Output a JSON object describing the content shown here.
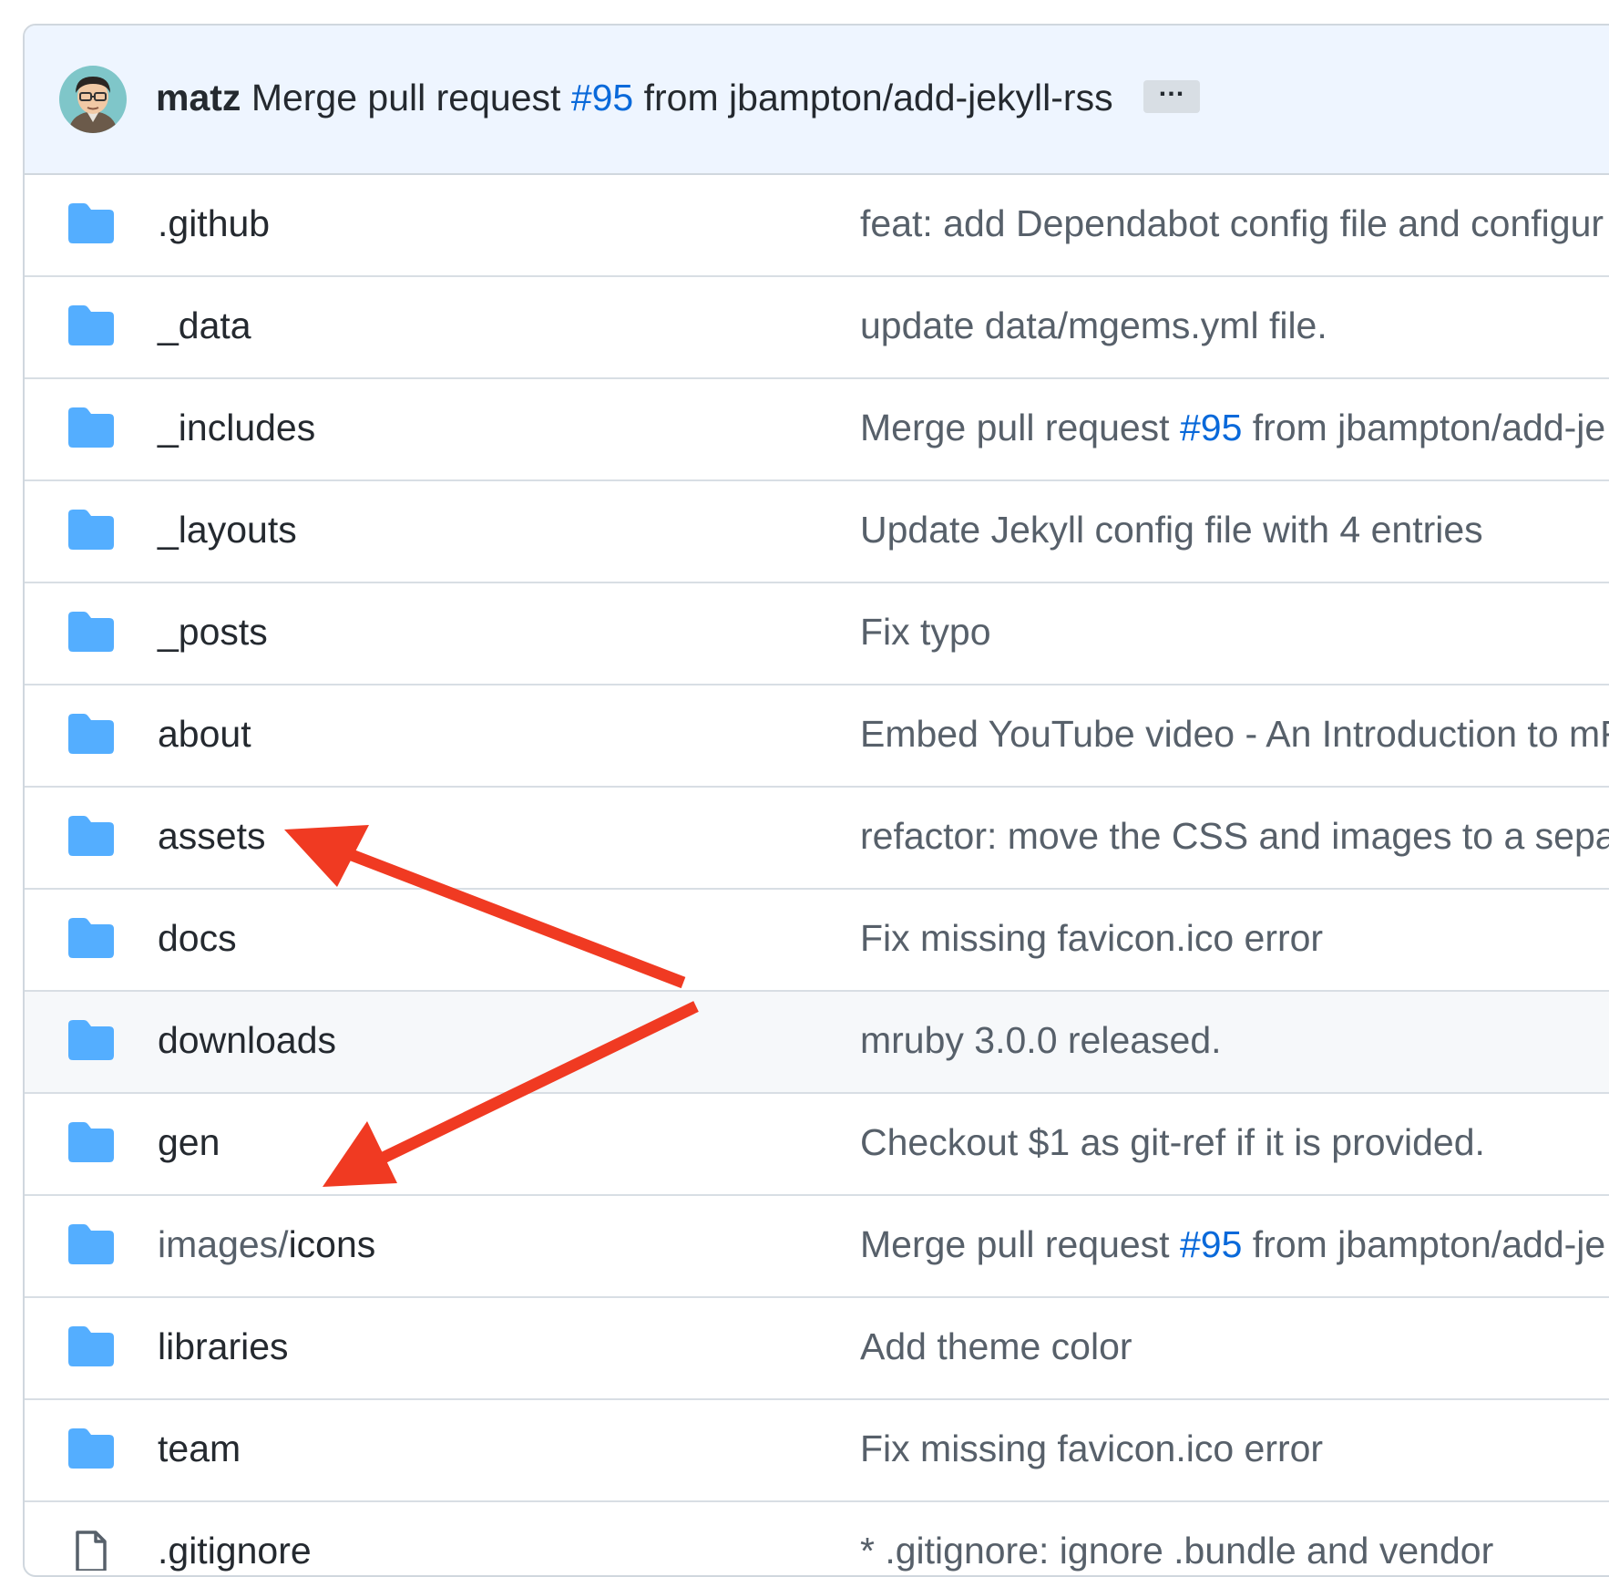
{
  "header": {
    "author": "matz",
    "message_prefix": "Merge pull request",
    "pr_link": "#95",
    "message_suffix": "from jbampton/add-jekyll-rss",
    "ellipsis": "…"
  },
  "rows": [
    {
      "type": "folder",
      "name": ".github",
      "msg_before": "feat: add Dependabot config file and configur",
      "msg_link": "",
      "msg_after": ""
    },
    {
      "type": "folder",
      "name": "_data",
      "msg_before": "update data/mgems.yml file.",
      "msg_link": "",
      "msg_after": ""
    },
    {
      "type": "folder",
      "name": "_includes",
      "msg_before": "Merge pull request ",
      "msg_link": "#95",
      "msg_after": " from jbampton/add-je"
    },
    {
      "type": "folder",
      "name": "_layouts",
      "msg_before": "Update Jekyll config file with 4 entries",
      "msg_link": "",
      "msg_after": ""
    },
    {
      "type": "folder",
      "name": "_posts",
      "msg_before": "Fix typo",
      "msg_link": "",
      "msg_after": ""
    },
    {
      "type": "folder",
      "name": "about",
      "msg_before": "Embed YouTube video - An Introduction to mR",
      "msg_link": "",
      "msg_after": ""
    },
    {
      "type": "folder",
      "name": "assets",
      "msg_before": "refactor: move the CSS and images to a separ",
      "msg_link": "",
      "msg_after": ""
    },
    {
      "type": "folder",
      "name": "docs",
      "msg_before": "Fix missing favicon.ico error",
      "msg_link": "",
      "msg_after": ""
    },
    {
      "type": "folder",
      "name": "downloads",
      "msg_before": "mruby 3.0.0 released.",
      "msg_link": "",
      "msg_after": "",
      "hover": true
    },
    {
      "type": "folder",
      "name": "gen",
      "msg_before": "Checkout $1 as git-ref if it is provided.",
      "msg_link": "",
      "msg_after": ""
    },
    {
      "type": "folder",
      "name_prefix": "images/",
      "name": "icons",
      "msg_before": "Merge pull request ",
      "msg_link": "#95",
      "msg_after": " from jbampton/add-je"
    },
    {
      "type": "folder",
      "name": "libraries",
      "msg_before": "Add theme color",
      "msg_link": "",
      "msg_after": ""
    },
    {
      "type": "folder",
      "name": "team",
      "msg_before": "Fix missing favicon.ico error",
      "msg_link": "",
      "msg_after": ""
    },
    {
      "type": "file",
      "name": ".gitignore",
      "msg_before": "* .gitignore: ignore .bundle and vendor",
      "msg_link": "",
      "msg_after": ""
    }
  ],
  "colors": {
    "folder": "#54aeff",
    "link": "#0969da",
    "arrow": "#f03a22",
    "header_bg": "#eef5ff"
  }
}
